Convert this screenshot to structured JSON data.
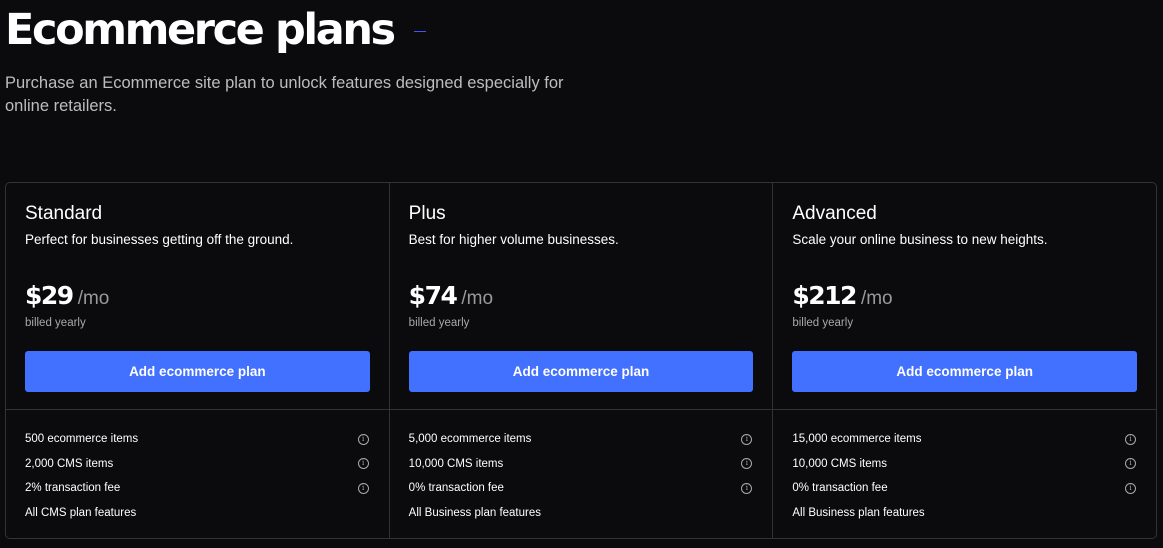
{
  "header": {
    "title": "Ecommerce plans",
    "subtitle": "Purchase an Ecommerce site plan to unlock features designed especially for online retailers."
  },
  "colors": {
    "background": "#0b0a0d",
    "accent_button": "#4270ff",
    "border": "#333333"
  },
  "plans": [
    {
      "name": "Standard",
      "description": "Perfect for businesses getting off the ground.",
      "price": "$29",
      "period": "/mo",
      "billing": "billed yearly",
      "button_label": "Add ecommerce plan",
      "features": [
        {
          "text": "500 ecommerce items",
          "info": true
        },
        {
          "text": "2,000 CMS items",
          "info": true
        },
        {
          "text": "2% transaction fee",
          "info": true
        },
        {
          "text": "All CMS plan features",
          "info": false
        }
      ]
    },
    {
      "name": "Plus",
      "description": "Best for higher volume businesses.",
      "price": "$74",
      "period": "/mo",
      "billing": "billed yearly",
      "button_label": "Add ecommerce plan",
      "features": [
        {
          "text": "5,000 ecommerce items",
          "info": true
        },
        {
          "text": "10,000 CMS items",
          "info": true
        },
        {
          "text": "0% transaction fee",
          "info": true
        },
        {
          "text": "All Business plan features",
          "info": false
        }
      ]
    },
    {
      "name": "Advanced",
      "description": "Scale your online business to new heights.",
      "price": "$212",
      "period": "/mo",
      "billing": "billed yearly",
      "button_label": "Add ecommerce plan",
      "features": [
        {
          "text": "15,000 ecommerce items",
          "info": true
        },
        {
          "text": "10,000 CMS items",
          "info": true
        },
        {
          "text": "0% transaction fee",
          "info": true
        },
        {
          "text": "All Business plan features",
          "info": false
        }
      ]
    }
  ]
}
